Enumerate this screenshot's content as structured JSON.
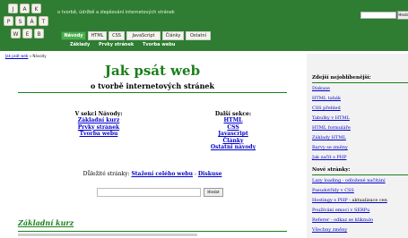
{
  "header": {
    "logo_letters": [
      "J",
      "A",
      "K",
      "P",
      "S",
      "Á",
      "T",
      "W",
      "E",
      "B"
    ],
    "tagline": "o tvorbě, údržbě a zlepšování internetových stránek",
    "search_button": "Hledat"
  },
  "nav": {
    "items": [
      "Návody",
      "HTML",
      "CSS",
      "JavaScript",
      "Články",
      "Ostatní"
    ],
    "sub_items": [
      "Základy",
      "Prvky stránek",
      "Tvorba webu"
    ]
  },
  "breadcrumb": {
    "home": "Jak psát web",
    "separator": "»",
    "current": "Návody"
  },
  "main": {
    "title": "Jak psát web",
    "subtitle": "o tvorbě internetových stránek",
    "section_heading": "V sekci Návody:",
    "section_links": [
      "Základní kurz",
      "Prvky stránek",
      "Tvorba webu"
    ],
    "other_heading": "Další sekce:",
    "other_links": [
      "HTML",
      "CSS",
      "Javascript",
      "Články",
      "Ostatní návody"
    ],
    "important_label": "Důležité stránky:",
    "important_links": [
      "Stažení celého webu",
      "Diskuse"
    ],
    "important_sep": "-",
    "search_button": "Hledat",
    "course_heading": "Základní kurz"
  },
  "sidebar": {
    "popular_heading": "Zdejší nejoblíbenější:",
    "popular_links": [
      "Diskuse",
      "HTML tahák",
      "CSS přehled",
      "Tabulky v HTML",
      "HTML formuláře",
      "Základy HTML",
      "Barvy se změny",
      "Jak začít s PHP"
    ],
    "new_heading": "Nové stránky:",
    "new_links": [
      "Lazy loading - odložené načítání",
      "Pseudotřídy v CSS",
      "Hostingy s PHP",
      "Používání emoci v SERPu",
      "Referer - odkaz se kliknulo",
      "Všechny změny"
    ],
    "new_extra": "- aktualizace cen"
  }
}
